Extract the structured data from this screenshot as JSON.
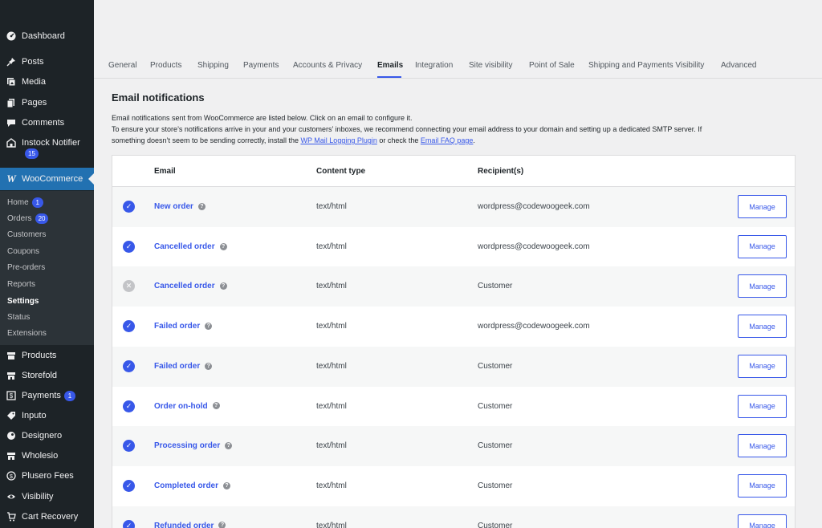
{
  "sidebar": {
    "top_items": [
      {
        "label": "Dashboard",
        "icon": "dashboard-icon"
      },
      {
        "label": "Posts",
        "icon": "pin-icon"
      },
      {
        "label": "Media",
        "icon": "media-icon"
      },
      {
        "label": "Pages",
        "icon": "pages-icon"
      },
      {
        "label": "Comments",
        "icon": "comment-icon"
      },
      {
        "label": "Instock Notifier",
        "icon": "bell-icon",
        "badge": "15"
      }
    ],
    "woocommerce": {
      "label": "WooCommerce",
      "icon": "woo-icon"
    },
    "submenu": [
      {
        "label": "Home",
        "badge": "1"
      },
      {
        "label": "Orders",
        "badge": "20"
      },
      {
        "label": "Customers"
      },
      {
        "label": "Coupons"
      },
      {
        "label": "Pre-orders"
      },
      {
        "label": "Reports"
      },
      {
        "label": "Settings",
        "current": true
      },
      {
        "label": "Status"
      },
      {
        "label": "Extensions"
      }
    ],
    "bottom_items": [
      {
        "label": "Products",
        "icon": "archive-icon"
      },
      {
        "label": "Storefold",
        "icon": "store-icon"
      },
      {
        "label": "Payments",
        "icon": "dollar-icon",
        "badge": "1"
      },
      {
        "label": "Inputo",
        "icon": "tag-icon"
      },
      {
        "label": "Designero",
        "icon": "palette-icon"
      },
      {
        "label": "Wholesio",
        "icon": "store-icon"
      },
      {
        "label": "Plusero Fees",
        "icon": "coin-icon"
      },
      {
        "label": "Visibility",
        "icon": "eye-icon"
      },
      {
        "label": "Cart Recovery",
        "icon": "cart-icon"
      }
    ]
  },
  "tabs": [
    {
      "label": "General"
    },
    {
      "label": "Products"
    },
    {
      "label": "Shipping"
    },
    {
      "label": "Payments"
    },
    {
      "label": "Accounts & Privacy"
    },
    {
      "label": "Emails",
      "active": true
    },
    {
      "label": "Integration"
    },
    {
      "label": "Site visibility"
    },
    {
      "label": "Point of Sale"
    },
    {
      "label": "Shipping and Payments Visibility"
    },
    {
      "label": "Advanced"
    }
  ],
  "page": {
    "title": "Email notifications",
    "desc1": "Email notifications sent from WooCommerce are listed below. Click on an email to configure it.",
    "desc2": "To ensure your store’s notifications arrive in your and your customers’ inboxes, we recommend connecting your email address to your domain and setting up a dedicated SMTP server. If",
    "desc3_pre": "something doesn’t seem to be sending correctly, install the ",
    "desc3_link1": "WP Mail Logging Plugin",
    "desc3_mid": " or check the ",
    "desc3_link2": "Email FAQ page",
    "desc3_post": "."
  },
  "table": {
    "headers": {
      "email": "Email",
      "content_type": "Content type",
      "recipients": "Recipient(s)"
    },
    "manage_label": "Manage",
    "rows": [
      {
        "enabled": true,
        "name": "New order",
        "content_type": "text/html",
        "recipient": "wordpress@codewoogeek.com"
      },
      {
        "enabled": true,
        "name": "Cancelled order",
        "content_type": "text/html",
        "recipient": "wordpress@codewoogeek.com"
      },
      {
        "enabled": false,
        "name": "Cancelled order",
        "content_type": "text/html",
        "recipient": "Customer"
      },
      {
        "enabled": true,
        "name": "Failed order",
        "content_type": "text/html",
        "recipient": "wordpress@codewoogeek.com"
      },
      {
        "enabled": true,
        "name": "Failed order",
        "content_type": "text/html",
        "recipient": "Customer"
      },
      {
        "enabled": true,
        "name": "Order on-hold",
        "content_type": "text/html",
        "recipient": "Customer"
      },
      {
        "enabled": true,
        "name": "Processing order",
        "content_type": "text/html",
        "recipient": "Customer"
      },
      {
        "enabled": true,
        "name": "Completed order",
        "content_type": "text/html",
        "recipient": "Customer"
      },
      {
        "enabled": true,
        "name": "Refunded order",
        "content_type": "text/html",
        "recipient": "Customer"
      }
    ]
  },
  "colors": {
    "accent": "#3858e9",
    "admin_blue": "#2271b1",
    "sidebar": "#1d2327"
  }
}
